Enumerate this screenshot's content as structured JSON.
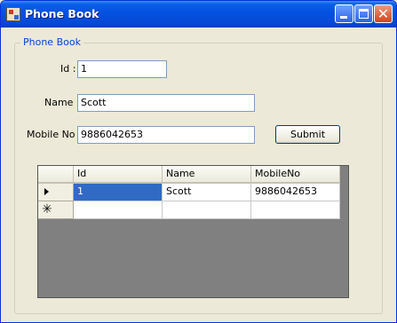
{
  "window": {
    "title": "Phone Book",
    "close_glyph": "✕"
  },
  "group": {
    "title": "Phone Book"
  },
  "form": {
    "id_label": "Id :",
    "id_value": "1",
    "name_label": "Name :",
    "name_value": "Scott",
    "mobile_label": "Mobile No :",
    "mobile_value": "9886042653",
    "submit_label": "Submit"
  },
  "grid": {
    "columns": [
      "Id",
      "Name",
      "MobileNo"
    ],
    "rows": [
      {
        "id": "1",
        "name": "Scott",
        "mobile": "9886042653"
      }
    ],
    "new_row_glyph": "✳"
  },
  "colors": {
    "selection": "#316ac5",
    "window_background": "#ece9d8",
    "grid_background": "#808080"
  },
  "icons": [
    "app-icon",
    "minimize-icon",
    "maximize-icon",
    "close-icon",
    "current-row-arrow-icon",
    "new-row-asterisk-icon"
  ]
}
